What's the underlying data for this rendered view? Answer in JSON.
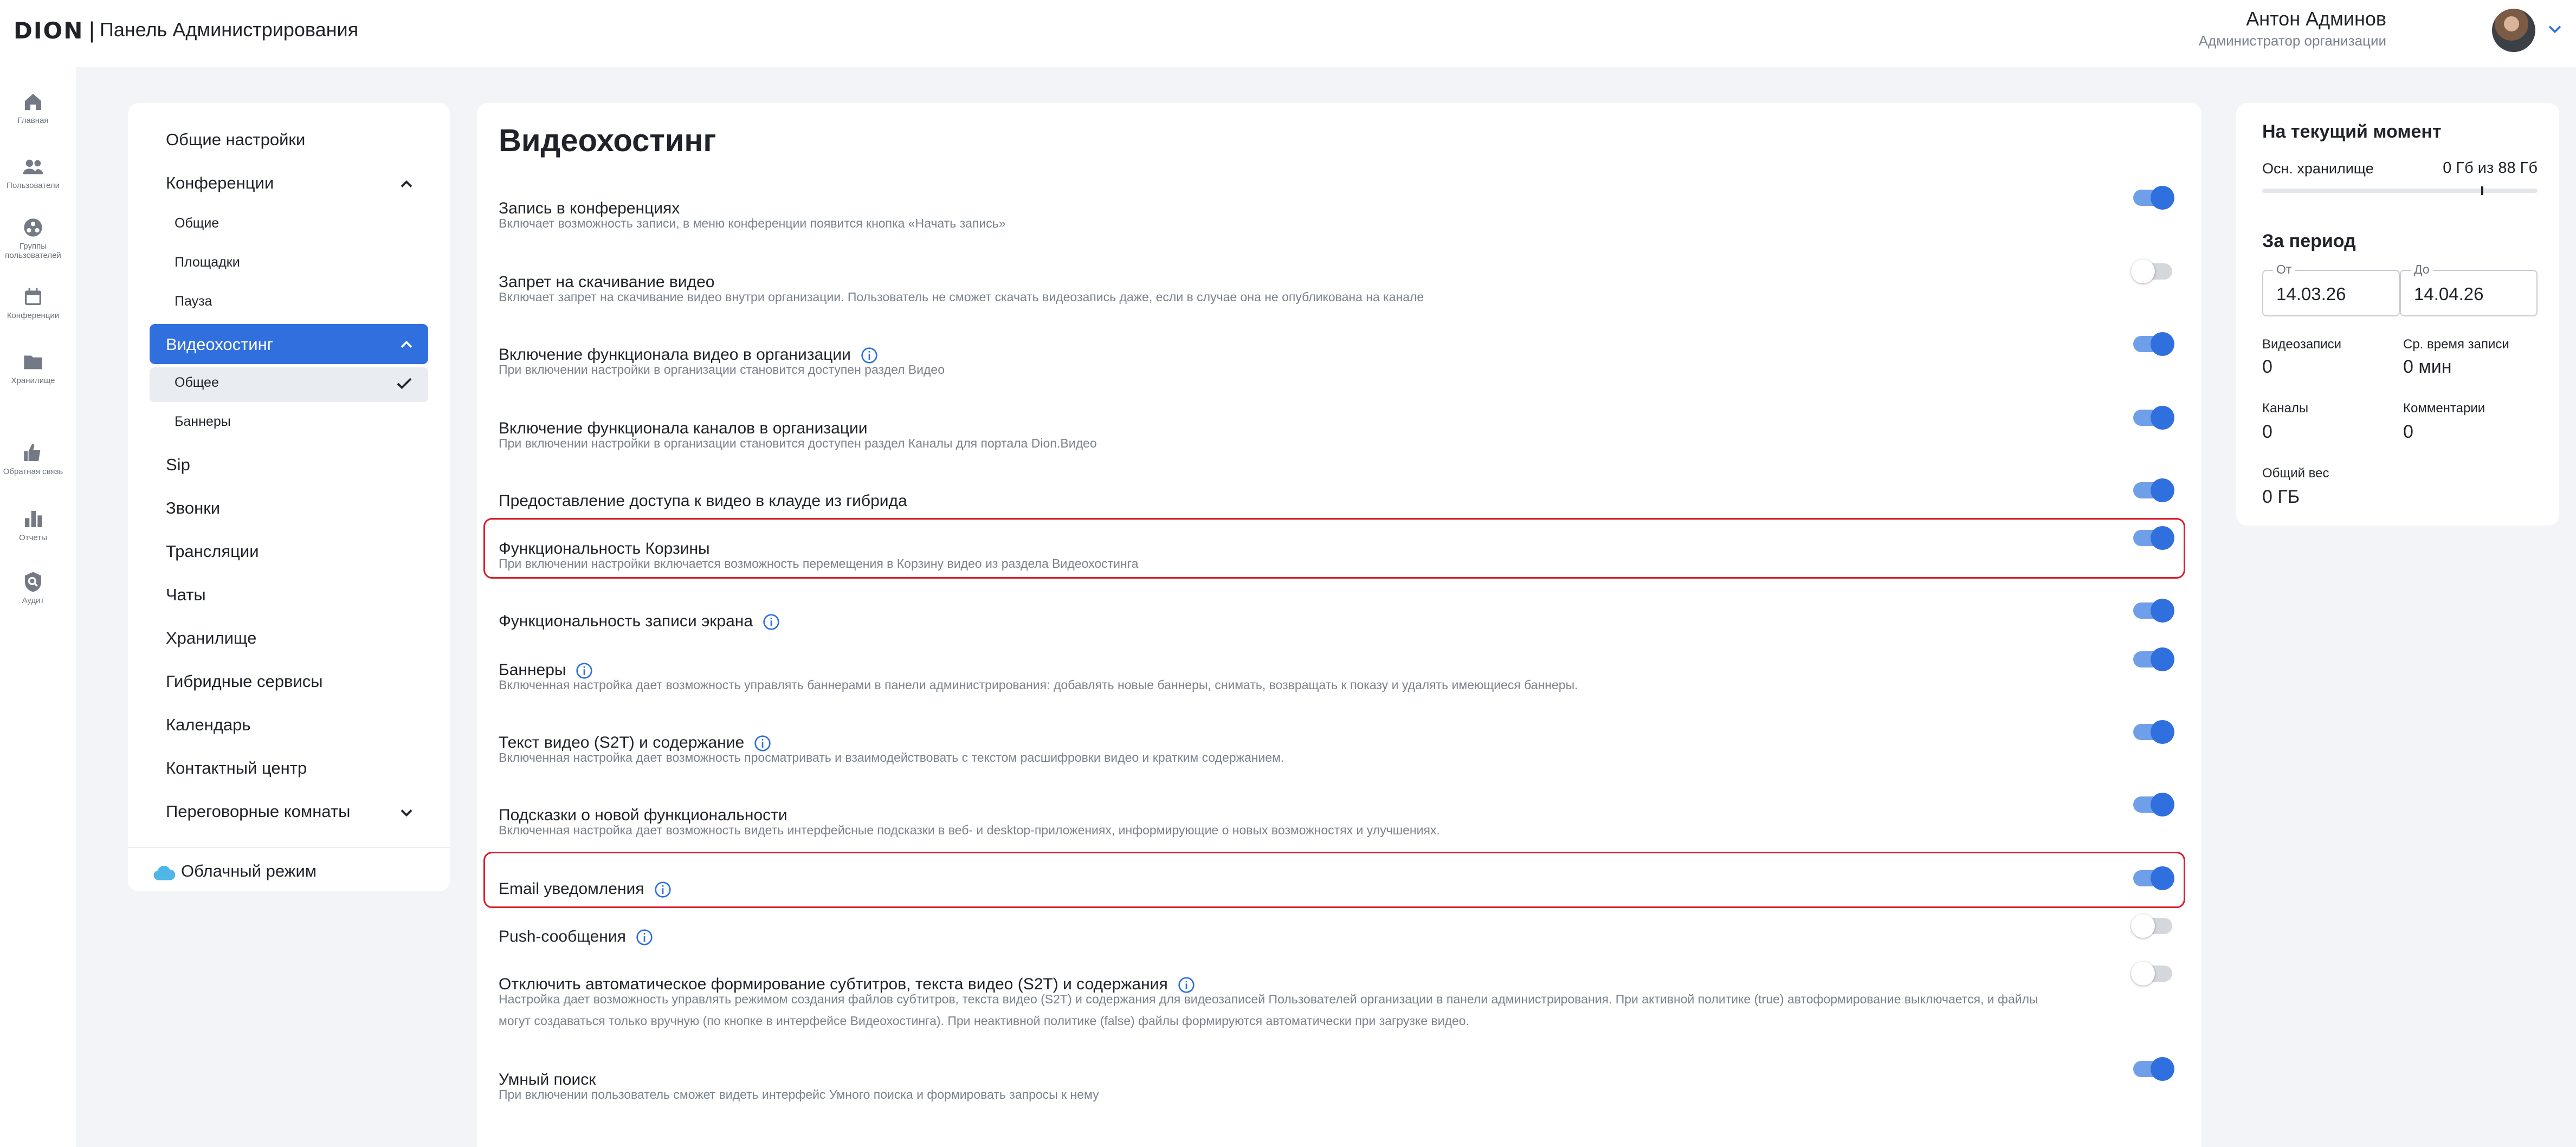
{
  "header": {
    "logo": "DION",
    "app_title": "Панель Администрирования",
    "user_name": "Антон Админов",
    "user_role": "Администратор организации"
  },
  "rail": [
    {
      "label": "Главная",
      "icon": "home-icon"
    },
    {
      "label": "Пользователи",
      "icon": "users-icon"
    },
    {
      "label": "Группы пользователей",
      "icon": "user-groups-icon"
    },
    {
      "label": "Конференции",
      "icon": "calendar-icon"
    },
    {
      "label": "Хранилище",
      "icon": "folder-icon"
    },
    {
      "label": "Обратная связь",
      "icon": "feedback-icon"
    },
    {
      "label": "Отчеты",
      "icon": "bar-chart-icon"
    },
    {
      "label": "Аудит",
      "icon": "audit-shield-icon"
    }
  ],
  "nav": {
    "general": "Общие настройки",
    "conferences": "Конференции",
    "conf_sub": [
      "Общие",
      "Площадки",
      "Пауза"
    ],
    "videohosting": "Видеохостинг",
    "vh_sub": [
      "Общее",
      "Баннеры"
    ],
    "items": [
      "Sip",
      "Звонки",
      "Трансляции",
      "Чаты",
      "Хранилище",
      "Гибридные сервисы",
      "Календарь",
      "Контактный центр",
      "Переговорные комнаты"
    ],
    "cloud_mode": "Облачный режим"
  },
  "main": {
    "title": "Видеохостинг",
    "settings": [
      {
        "title": "Запись в конференциях",
        "desc": "Включает возможность записи, в меню конференции появится кнопка «Начать запись»",
        "on": true,
        "info": false
      },
      {
        "title": "Запрет на скачивание видео",
        "desc": "Включает запрет на скачивание видео внутри организации. Пользователь не сможет скачать видеозапись даже, если в случае она не опубликована на канале",
        "on": false,
        "info": false
      },
      {
        "title": "Включение функционала видео в организации",
        "desc": "При включении настройки в организации становится доступен раздел Видео",
        "on": true,
        "info": true
      },
      {
        "title": "Включение функционала каналов в организации",
        "desc": "При включении настройки в организации становится доступен раздел Каналы для портала Dion.Видео",
        "on": true,
        "info": false
      },
      {
        "title": "Предоставление доступа к видео в клауде из гибрида",
        "desc": "",
        "on": true,
        "info": false
      },
      {
        "title": "Функциональность Корзины",
        "desc": "При включении настройки включается возможность перемещения в Корзину видео из раздела Видеохостинга",
        "on": true,
        "info": false,
        "highlight": true
      },
      {
        "title": "Функциональность записи экрана",
        "desc": "",
        "on": true,
        "info": true
      },
      {
        "title": "Баннеры",
        "desc": "Включенная настройка дает возможность управлять баннерами в панели администрирования: добавлять новые баннеры, снимать, возвращать к показу и удалять имеющиеся баннеры.",
        "on": true,
        "info": true
      },
      {
        "title": "Текст видео (S2T) и содержание",
        "desc": "Включенная настройка дает возможность просматривать и взаимодействовать с текстом расшифровки видео и кратким содержанием.",
        "on": true,
        "info": true
      },
      {
        "title": "Подсказки о новой функциональности",
        "desc": "Включенная настройка дает возможность видеть интерфейсные подсказки в веб- и desktop-приложениях, информирующие о новых возможностях и улучшениях.",
        "on": true,
        "info": false
      },
      {
        "title": "Email уведомления",
        "desc": "",
        "on": true,
        "info": true,
        "highlight": true
      },
      {
        "title": "Push-сообщения",
        "desc": "",
        "on": false,
        "info": true
      },
      {
        "title": "Отключить автоматическое формирование субтитров, текста видео (S2T) и содержания",
        "desc": "Настройка дает возможность управлять режимом создания файлов субтитров, текста видео (S2T) и содержания для видеозаписей Пользователей организации в панели администрирования. При активной политике (true) автоформирование выключается, и файлы могут создаваться только вручную (по кнопке в интерфейсе Видеохостинга). При неактивной политике (false) файлы формируются автоматически при загрузке видео.",
        "on": false,
        "info": true
      },
      {
        "title": "Умный поиск",
        "desc": "При включении пользователь сможет видеть интерфейс Умного поиска и формировать запросы к нему",
        "on": true,
        "info": false
      }
    ]
  },
  "stats": {
    "now_title": "На текущий момент",
    "storage_label": "Осн. хранилище",
    "storage_value": "0 Гб из 88 Гб",
    "storage_fraction": 0.0,
    "period_title": "За период",
    "from_label": "От",
    "from_value": "14.03.26",
    "to_label": "До",
    "to_value": "14.04.26",
    "videos_label": "Видеозаписи",
    "videos_value": "0",
    "avg_time_label": "Ср. время записи",
    "avg_time_value": "0 мин",
    "channels_label": "Каналы",
    "channels_value": "0",
    "comments_label": "Комментарии",
    "comments_value": "0",
    "weight_label": "Общий вес",
    "weight_value": "0 ГБ"
  },
  "colors": {
    "accent": "#2f6fde",
    "highlight": "#d71f2d",
    "background": "#f2f4f7"
  }
}
